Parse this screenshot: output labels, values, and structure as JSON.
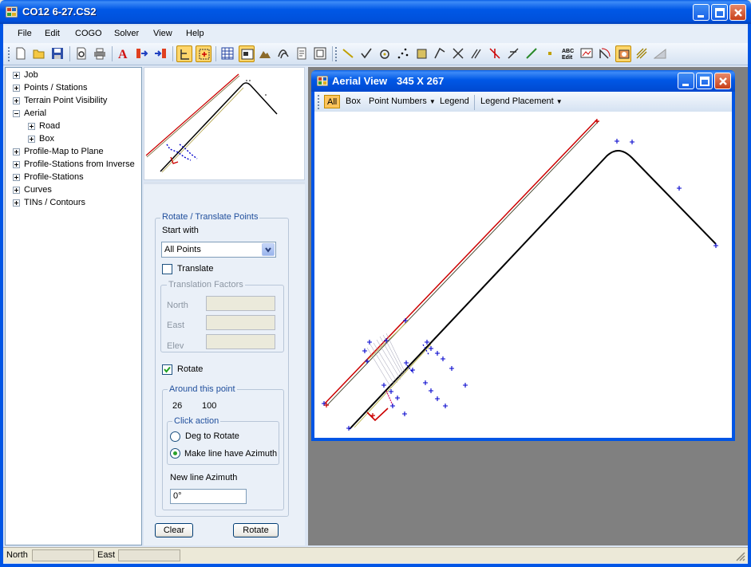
{
  "window": {
    "title": "CO12 6-27.CS2"
  },
  "menu": [
    "File",
    "Edit",
    "COGO",
    "Solver",
    "View",
    "Help"
  ],
  "tree": [
    {
      "label": "Job",
      "expanded": false,
      "level": 0
    },
    {
      "label": "Points / Stations",
      "expanded": false,
      "level": 0
    },
    {
      "label": "Terrain Point Visibility",
      "expanded": false,
      "level": 0
    },
    {
      "label": "Aerial",
      "expanded": true,
      "level": 0
    },
    {
      "label": "Road",
      "expanded": false,
      "level": 1
    },
    {
      "label": "Box",
      "expanded": false,
      "level": 1
    },
    {
      "label": "Profile-Map to Plane",
      "expanded": false,
      "level": 0
    },
    {
      "label": "Profile-Stations from Inverse",
      "expanded": false,
      "level": 0
    },
    {
      "label": "Profile-Stations",
      "expanded": false,
      "level": 0
    },
    {
      "label": "Curves",
      "expanded": false,
      "level": 0
    },
    {
      "label": "TINs / Contours",
      "expanded": false,
      "level": 0
    }
  ],
  "panel": {
    "group_title": "Rotate / Translate Points",
    "start_with_label": "Start with",
    "start_with_value": "All Points",
    "translate_label": "Translate",
    "translate_checked": false,
    "translation_group": "Translation Factors",
    "north_label": "North",
    "east_label": "East",
    "elev_label": "Elev",
    "rotate_label": "Rotate",
    "rotate_checked": true,
    "around_group": "Around this point",
    "around_a": "26",
    "around_b": "100",
    "click_action_group": "Click action",
    "deg_label": "Deg to Rotate",
    "azimuth_label": "Make line have Azimuth",
    "new_azimuth_label": "New line Azimuth",
    "new_azimuth_value": "0°",
    "clear_button": "Clear",
    "rotate_button": "Rotate"
  },
  "aerial": {
    "title": "Aerial View",
    "size": "345  X  267",
    "toolbar": [
      "All",
      "Box",
      "Point Numbers",
      "Legend",
      "Legend Placement"
    ]
  },
  "status": {
    "north_label": "North",
    "east_label": "East"
  },
  "colors": {
    "title_blue": "#0055E5",
    "point_blue": "#0000CC",
    "line_red": "#CC0000",
    "highlight": "#FFC45A"
  }
}
